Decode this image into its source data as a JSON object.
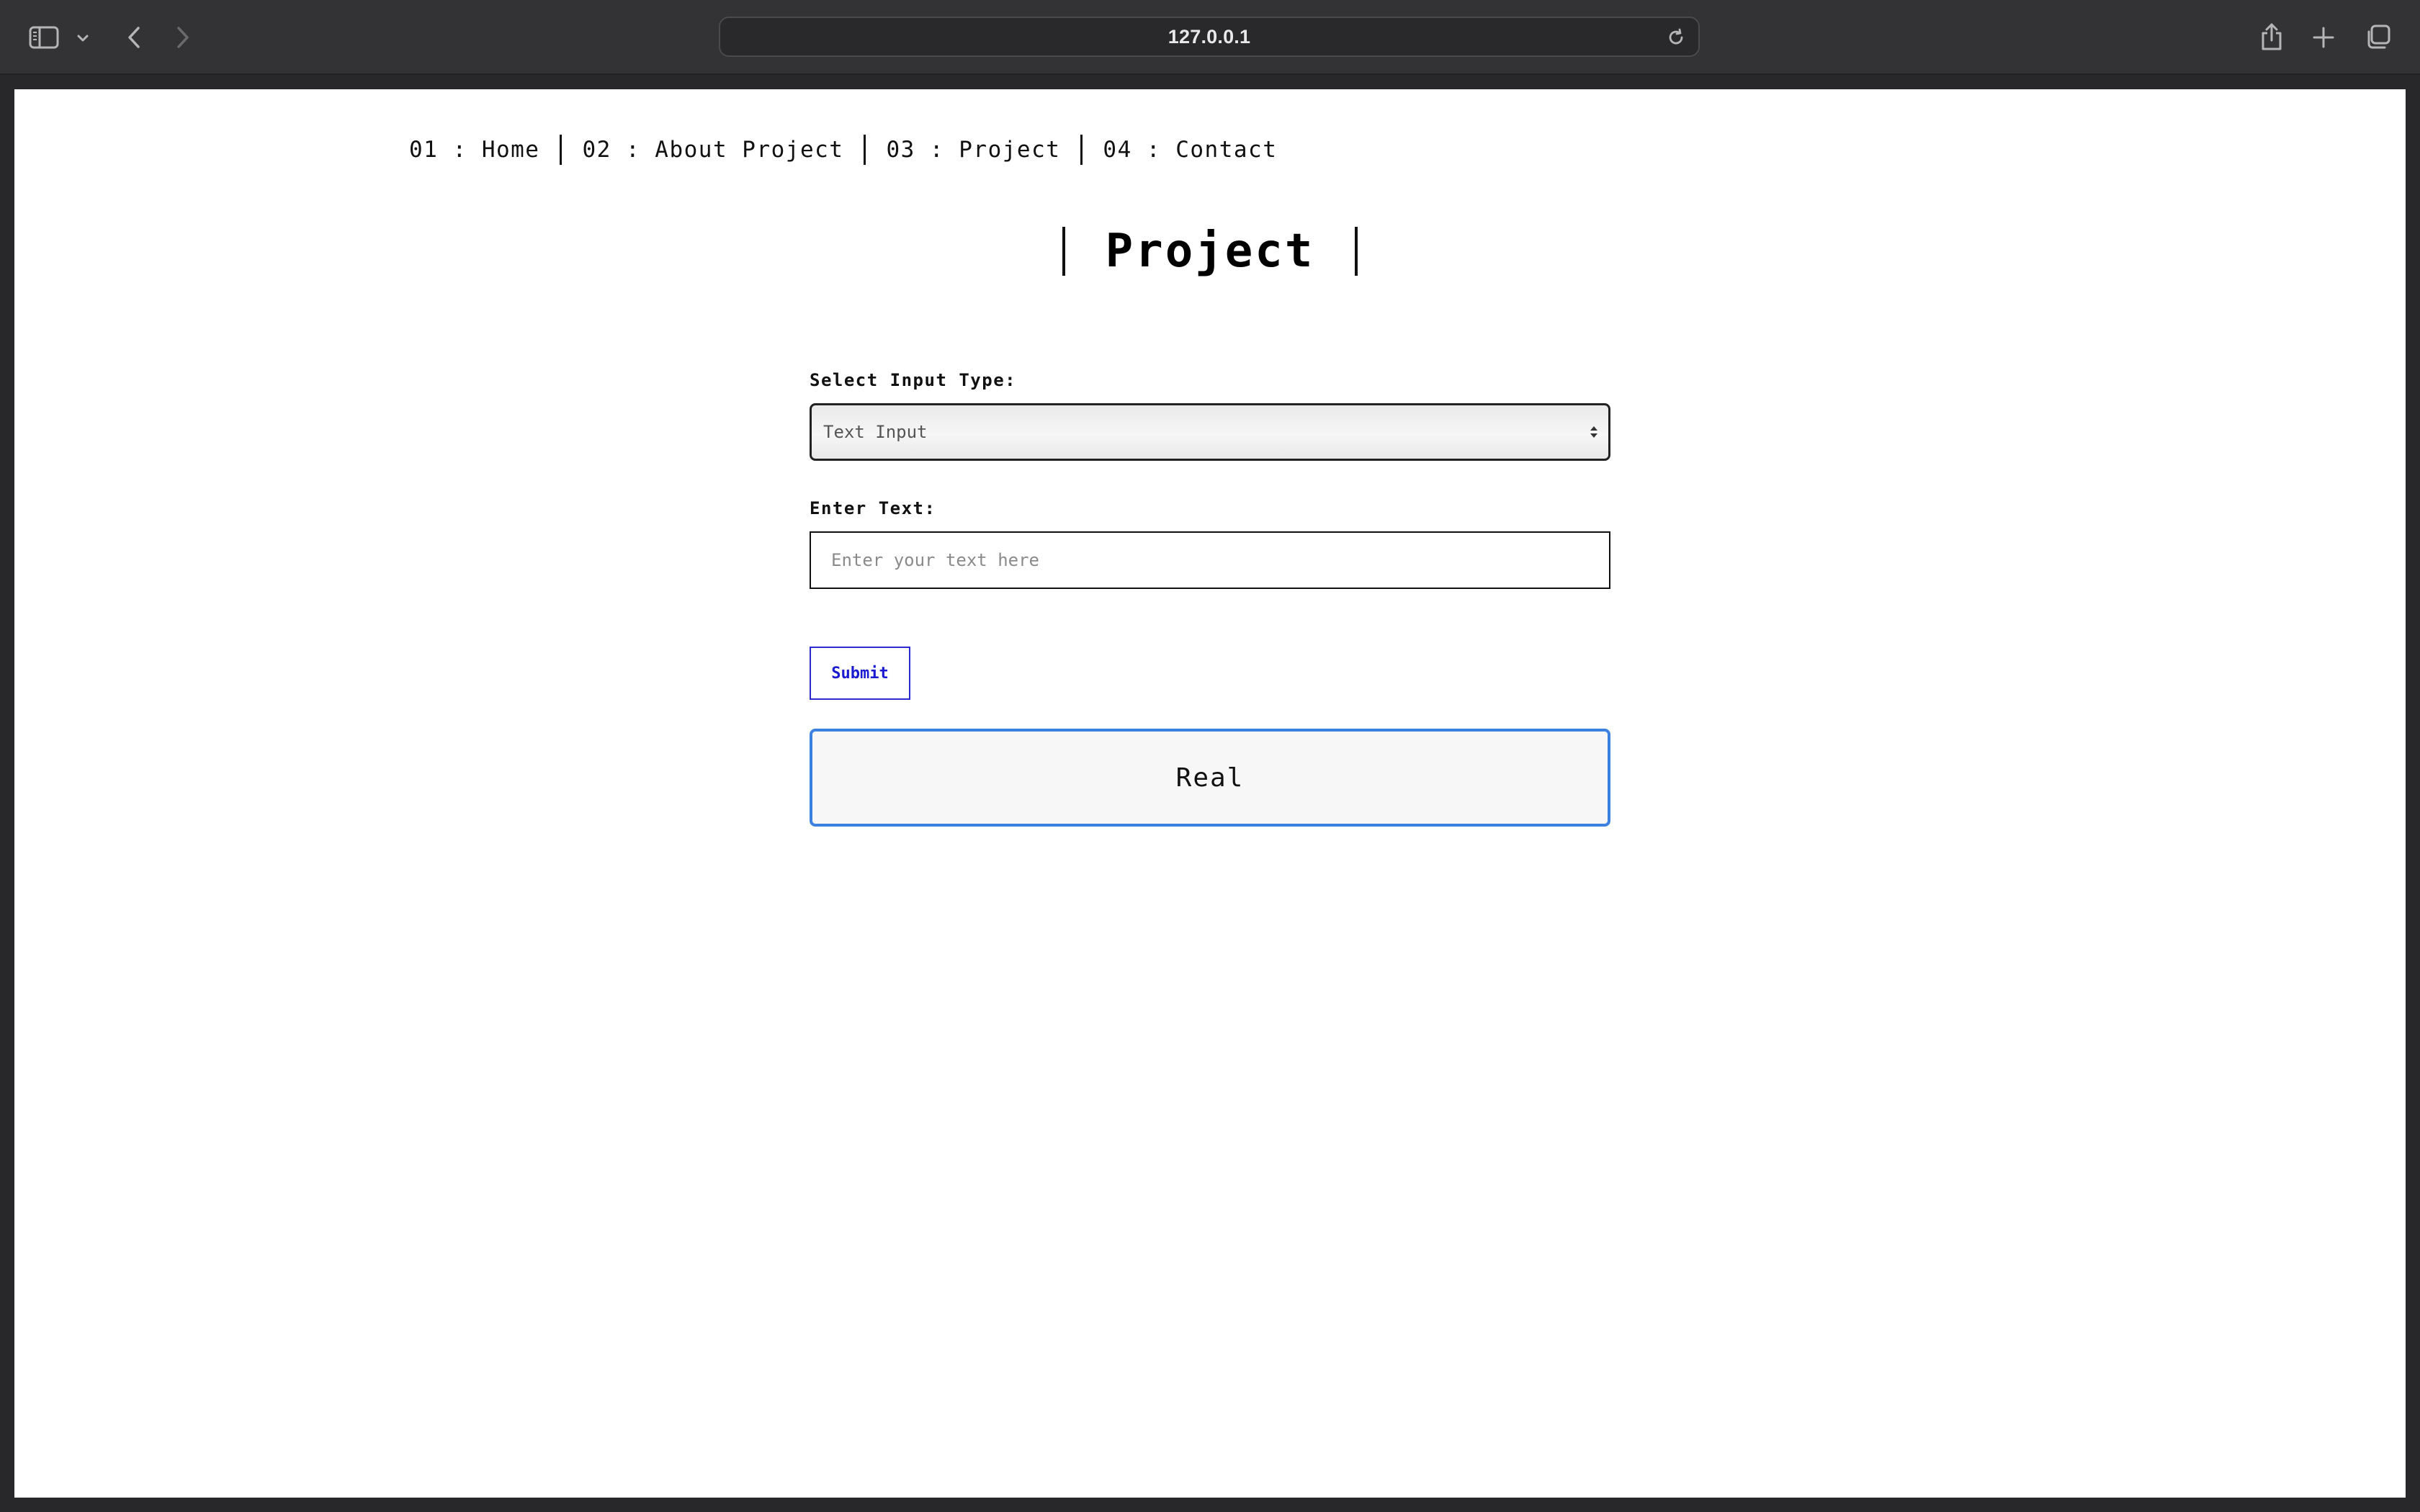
{
  "browser": {
    "url": "127.0.0.1",
    "icons": {
      "sidebar": "sidebar-icon",
      "sidebar_menu": "chevron-down-icon",
      "back": "chevron-left-icon",
      "forward": "chevron-right-icon",
      "reload": "reload-icon",
      "share": "share-icon",
      "new_tab": "plus-icon",
      "tab_overview": "tabs-icon"
    },
    "colors": {
      "chrome": "#333335",
      "url_text": "#e8e8ea"
    }
  },
  "nav": {
    "items": [
      {
        "label": "01 : Home"
      },
      {
        "label": "02 : About Project"
      },
      {
        "label": "03 : Project"
      },
      {
        "label": "04 : Contact"
      }
    ]
  },
  "page": {
    "title": "Project"
  },
  "form": {
    "select_label": "Select Input Type:",
    "select_value": "Text Input",
    "text_label": "Enter Text:",
    "text_placeholder": "Enter your text here",
    "text_value": "",
    "submit_label": "Submit",
    "result": "Real",
    "colors": {
      "submit": "#1a1ad0",
      "result_border": "#3b82e0"
    }
  }
}
